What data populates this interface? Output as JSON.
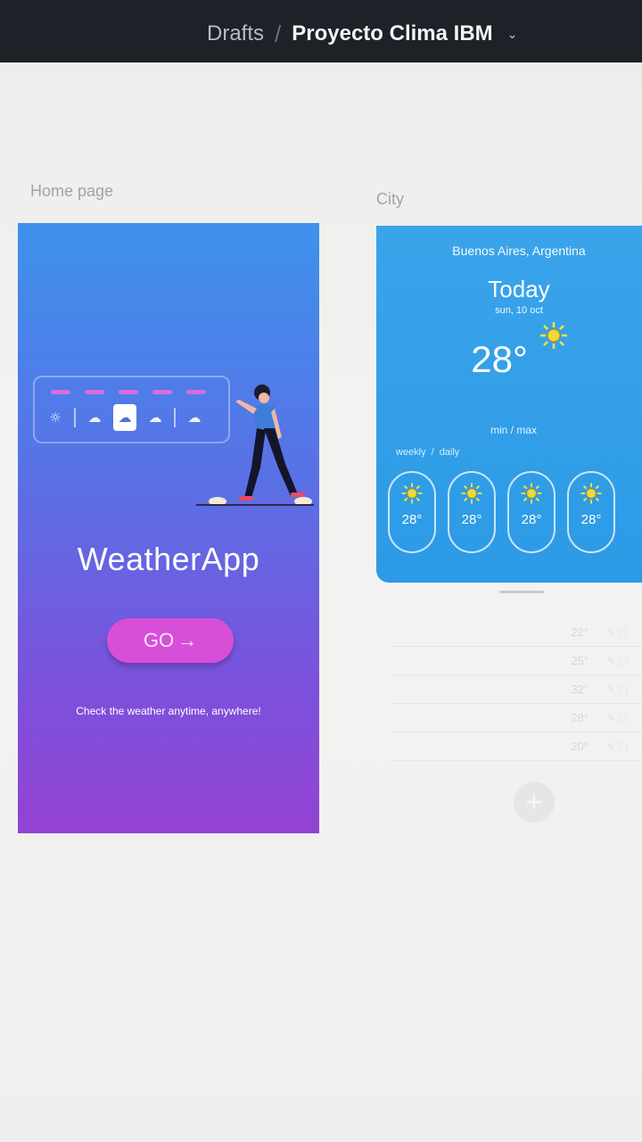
{
  "topbar": {
    "breadcrumb_root": "Drafts",
    "separator": "/",
    "project_name": "Proyecto Clima IBM"
  },
  "frames": {
    "home_label": "Home page",
    "city_label": "City"
  },
  "home": {
    "app_title": "WeatherApp",
    "go_button_label": "GO",
    "tagline": "Check the weather anytime, anywhere!"
  },
  "city": {
    "location": "Buenos Aires, Argentina",
    "today_label": "Today",
    "date": "sun, 10 oct",
    "temperature": "28°",
    "min_max_label": "min / max",
    "tabs": [
      "weekly",
      "/",
      "daily"
    ],
    "forecast": [
      {
        "temp": "28°",
        "icon": "sun-icon"
      },
      {
        "temp": "28°",
        "icon": "sun-icon"
      },
      {
        "temp": "28°",
        "icon": "sun-icon"
      },
      {
        "temp": "28°",
        "icon": "sun-icon"
      }
    ],
    "list": [
      {
        "temp": "22°"
      },
      {
        "temp": "25°"
      },
      {
        "temp": "32°"
      },
      {
        "temp": "28°"
      },
      {
        "temp": "20°"
      }
    ],
    "add_button_label": "+"
  },
  "colors": {
    "accent": "#d74fd9",
    "home_gradient_top": "#3e92ec",
    "home_gradient_bottom": "#9442d2",
    "city_background": "#3aa4ea"
  }
}
